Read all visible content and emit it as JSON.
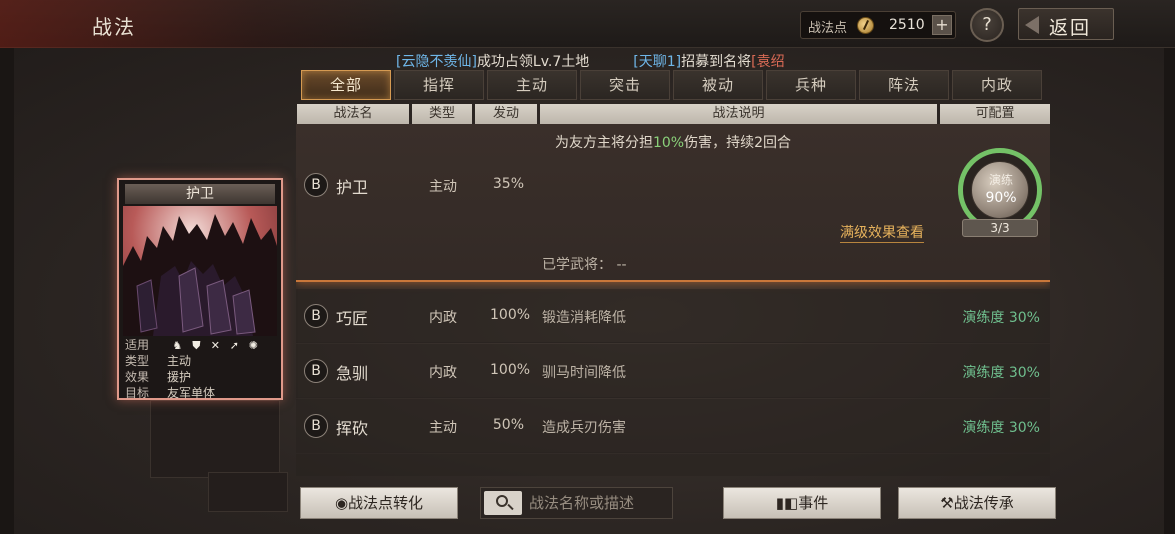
{
  "header": {
    "title": "战法",
    "points_label": "战法点",
    "points_value": "2510",
    "plus": "+",
    "help": "?",
    "back_label": "返回"
  },
  "ticker": {
    "msg1_tag": "[云隐不羡仙]",
    "msg1_text": "成功占领Lv.7土地",
    "msg2_tag": "[天聊1]",
    "msg2_text": "招募到名将",
    "msg2_name": "[袁绍"
  },
  "tabs": [
    "全部",
    "指挥",
    "主动",
    "突击",
    "被动",
    "兵种",
    "阵法",
    "内政"
  ],
  "columns": {
    "name": "战法名",
    "type": "类型",
    "trigger": "发动",
    "desc": "战法说明",
    "config": "可配置"
  },
  "expanded": {
    "grade": "B",
    "name": "护卫",
    "type": "主动",
    "trigger": "35%",
    "desc_prefix": "为友方主将分担",
    "desc_pct": "10%",
    "desc_suffix": "伤害，持续2回合",
    "learned": "已学武将：  --",
    "max_view": "满级效果查看",
    "orb_label": "演练",
    "orb_value": "90%",
    "count": "3/3"
  },
  "rows": [
    {
      "grade": "B",
      "name": "巧匠",
      "type": "内政",
      "trigger": "100%",
      "desc": "锻造消耗降低",
      "prof": "演练度 30%"
    },
    {
      "grade": "B",
      "name": "急驯",
      "type": "内政",
      "trigger": "100%",
      "desc": "驯马时间降低",
      "prof": "演练度 30%"
    },
    {
      "grade": "B",
      "name": "挥砍",
      "type": "主动",
      "trigger": "50%",
      "desc": "造成兵刃伤害",
      "prof": "演练度 30%"
    }
  ],
  "card": {
    "title": "护卫",
    "rows": [
      {
        "k": "适用",
        "icons": [
          "cavalry-icon",
          "shield-icon",
          "bow-icon",
          "spear-icon",
          "wheel-icon"
        ]
      },
      {
        "k": "类型",
        "v": "主动"
      },
      {
        "k": "效果",
        "v": "援护"
      },
      {
        "k": "目标",
        "v": "友军单体"
      }
    ]
  },
  "footer": {
    "convert_label": "战法点转化",
    "search_placeholder": "战法名称或描述",
    "event_label": "事件",
    "inherit_label": "战法传承"
  }
}
